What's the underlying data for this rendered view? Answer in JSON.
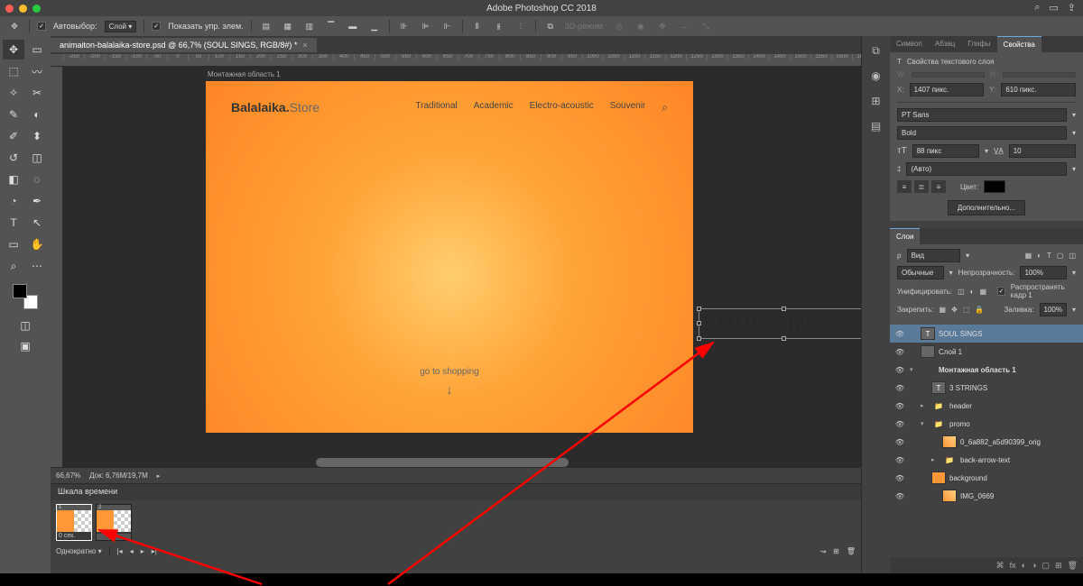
{
  "window": {
    "title": "Adobe Photoshop CC 2018"
  },
  "options": {
    "auto_select": "Автовыбор:",
    "auto_select_value": "Слой",
    "show_controls": "Показать упр. элем.",
    "mode_3d": "3D-режим:"
  },
  "doc": {
    "tab": "animaiton-balalaika-store.psd @ 66,7% (SOUL SINGS, RGB/8#) *",
    "zoom": "66,67%",
    "info": "Док: 6,76M/19,7M"
  },
  "artboard": {
    "label": "Монтажная область 1",
    "logo1": "Balalaika.",
    "logo2": "Store",
    "nav": [
      "Traditional",
      "Academic",
      "Electro-acoustic",
      "Souvenir"
    ],
    "cta": "go to shopping"
  },
  "selected_text": "SOUL SINGS",
  "ruler_values": [
    "-250",
    "-200",
    "-150",
    "-100",
    "-50",
    "0",
    "50",
    "100",
    "150",
    "200",
    "250",
    "300",
    "350",
    "400",
    "450",
    "500",
    "550",
    "600",
    "650",
    "700",
    "750",
    "800",
    "850",
    "900",
    "950",
    "1000",
    "1050",
    "1100",
    "1150",
    "1200",
    "1250",
    "1300",
    "1350",
    "1400",
    "1450",
    "1500",
    "1550",
    "1600",
    "1650",
    "1700",
    "1750",
    "1800",
    "1850",
    "1900",
    "19"
  ],
  "timeline": {
    "title": "Шкала времени",
    "frame_time": "0 сек.",
    "loop": "Однократно"
  },
  "panels": {
    "top_tabs": [
      "Символ",
      "Абзац",
      "Глифы",
      "Свойства"
    ],
    "prop_title": "Свойства текстового слоя",
    "x_label": "X:",
    "x_val": "1407 пикс.",
    "y_label": "Y:",
    "y_val": "610 пикс.",
    "w_label": "W:",
    "w_val": "",
    "h_label": "H:",
    "h_val": "",
    "font": "PT Sans",
    "weight": "Bold",
    "size": "88 пикс",
    "leading": "10",
    "tracking": "(Авто)",
    "color_label": "Цвет:",
    "more_btn": "Дополнительно...",
    "layers_tab": "Слои",
    "search": "Вид",
    "blend": "Обычные",
    "opacity_label": "Непрозрачность:",
    "opacity_val": "100%",
    "unify": "Унифицировать:",
    "propagate": "Распространять кадр 1",
    "lock_label": "Закрепить:",
    "fill_label": "Заливка:",
    "fill_val": "100%"
  },
  "layers": [
    {
      "name": "SOUL SINGS",
      "type": "text",
      "indent": 0,
      "selected": true
    },
    {
      "name": "Слой 1",
      "type": "layer",
      "indent": 0
    },
    {
      "name": "Монтажная область 1",
      "type": "artboard",
      "indent": 0,
      "open": true
    },
    {
      "name": "3 STRINGS",
      "type": "text",
      "indent": 1
    },
    {
      "name": "header",
      "type": "folder",
      "indent": 1
    },
    {
      "name": "promo",
      "type": "folder",
      "indent": 1,
      "open": true
    },
    {
      "name": "0_6a882_a5d90399_orig",
      "type": "smart",
      "indent": 2
    },
    {
      "name": "back-arrow-text",
      "type": "folder",
      "indent": 2
    },
    {
      "name": "background",
      "type": "layer-orange",
      "indent": 1
    },
    {
      "name": "IMG_0669",
      "type": "smart",
      "indent": 2
    }
  ]
}
